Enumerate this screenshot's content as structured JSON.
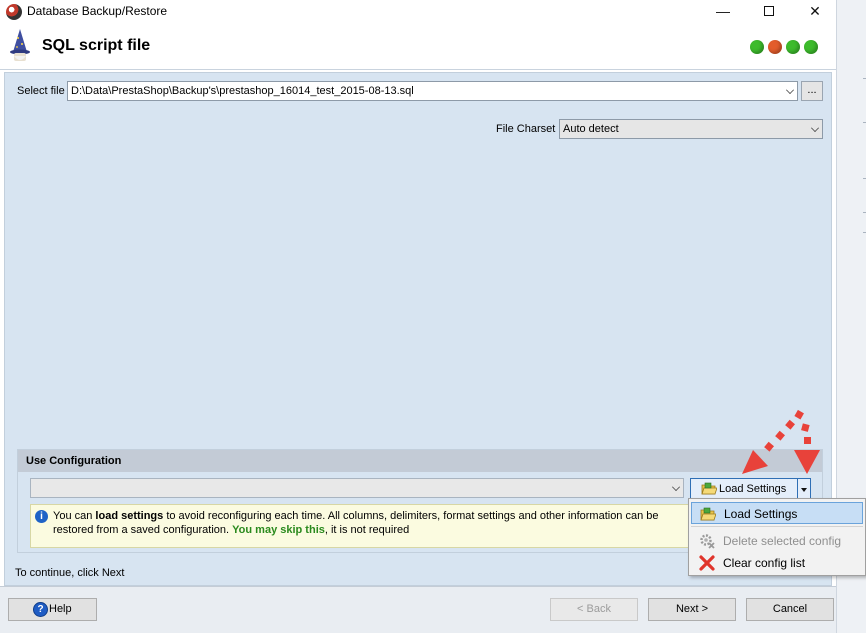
{
  "window": {
    "title": "Database Backup/Restore",
    "minimize_glyph": "—",
    "close_glyph": "✕"
  },
  "header": {
    "title": "SQL script file",
    "status_colors": [
      "#3dbb2c",
      "#e35c2b",
      "#3dbb2c",
      "#3dbb2c"
    ]
  },
  "form": {
    "select_file_label": "Select file",
    "file_path": "D:\\Data\\PrestaShop\\Backup's\\prestashop_16014_test_2015-08-13.sql",
    "browse_label": "...",
    "charset_label": "File Charset",
    "charset_value": "Auto detect"
  },
  "config": {
    "title": "Use Configuration",
    "selected": "",
    "load_button_label": "Load Settings",
    "info": {
      "text_before": "You can ",
      "bold": "load settings",
      "text_middle": " to avoid reconfiguring each time. All columns, delimiters, format settings and other information can be restored from a saved configuration. ",
      "skip": "You may skip this",
      "text_after": ", it is not required"
    }
  },
  "continue_text": "To continue, click Next",
  "menu": {
    "items": [
      {
        "label": "Load Settings",
        "icon": "folder-open-icon",
        "state": "highlighted"
      },
      {
        "label": "Delete selected config",
        "icon": "gear-delete-icon",
        "state": "disabled"
      },
      {
        "label": "Clear config list",
        "icon": "red-x-icon",
        "state": "enabled"
      }
    ]
  },
  "footer": {
    "help_label": "Help",
    "back_label": "< Back",
    "next_label": "Next >",
    "cancel_label": "Cancel"
  },
  "colors": {
    "panel_bg": "#d7e4f1",
    "group_header_bg": "#c3cbd6",
    "info_bg": "#fbfbe0",
    "accent_blue": "#2f6fb5",
    "annotation_red": "#e8423a",
    "skip_green": "#2a8a1d"
  }
}
